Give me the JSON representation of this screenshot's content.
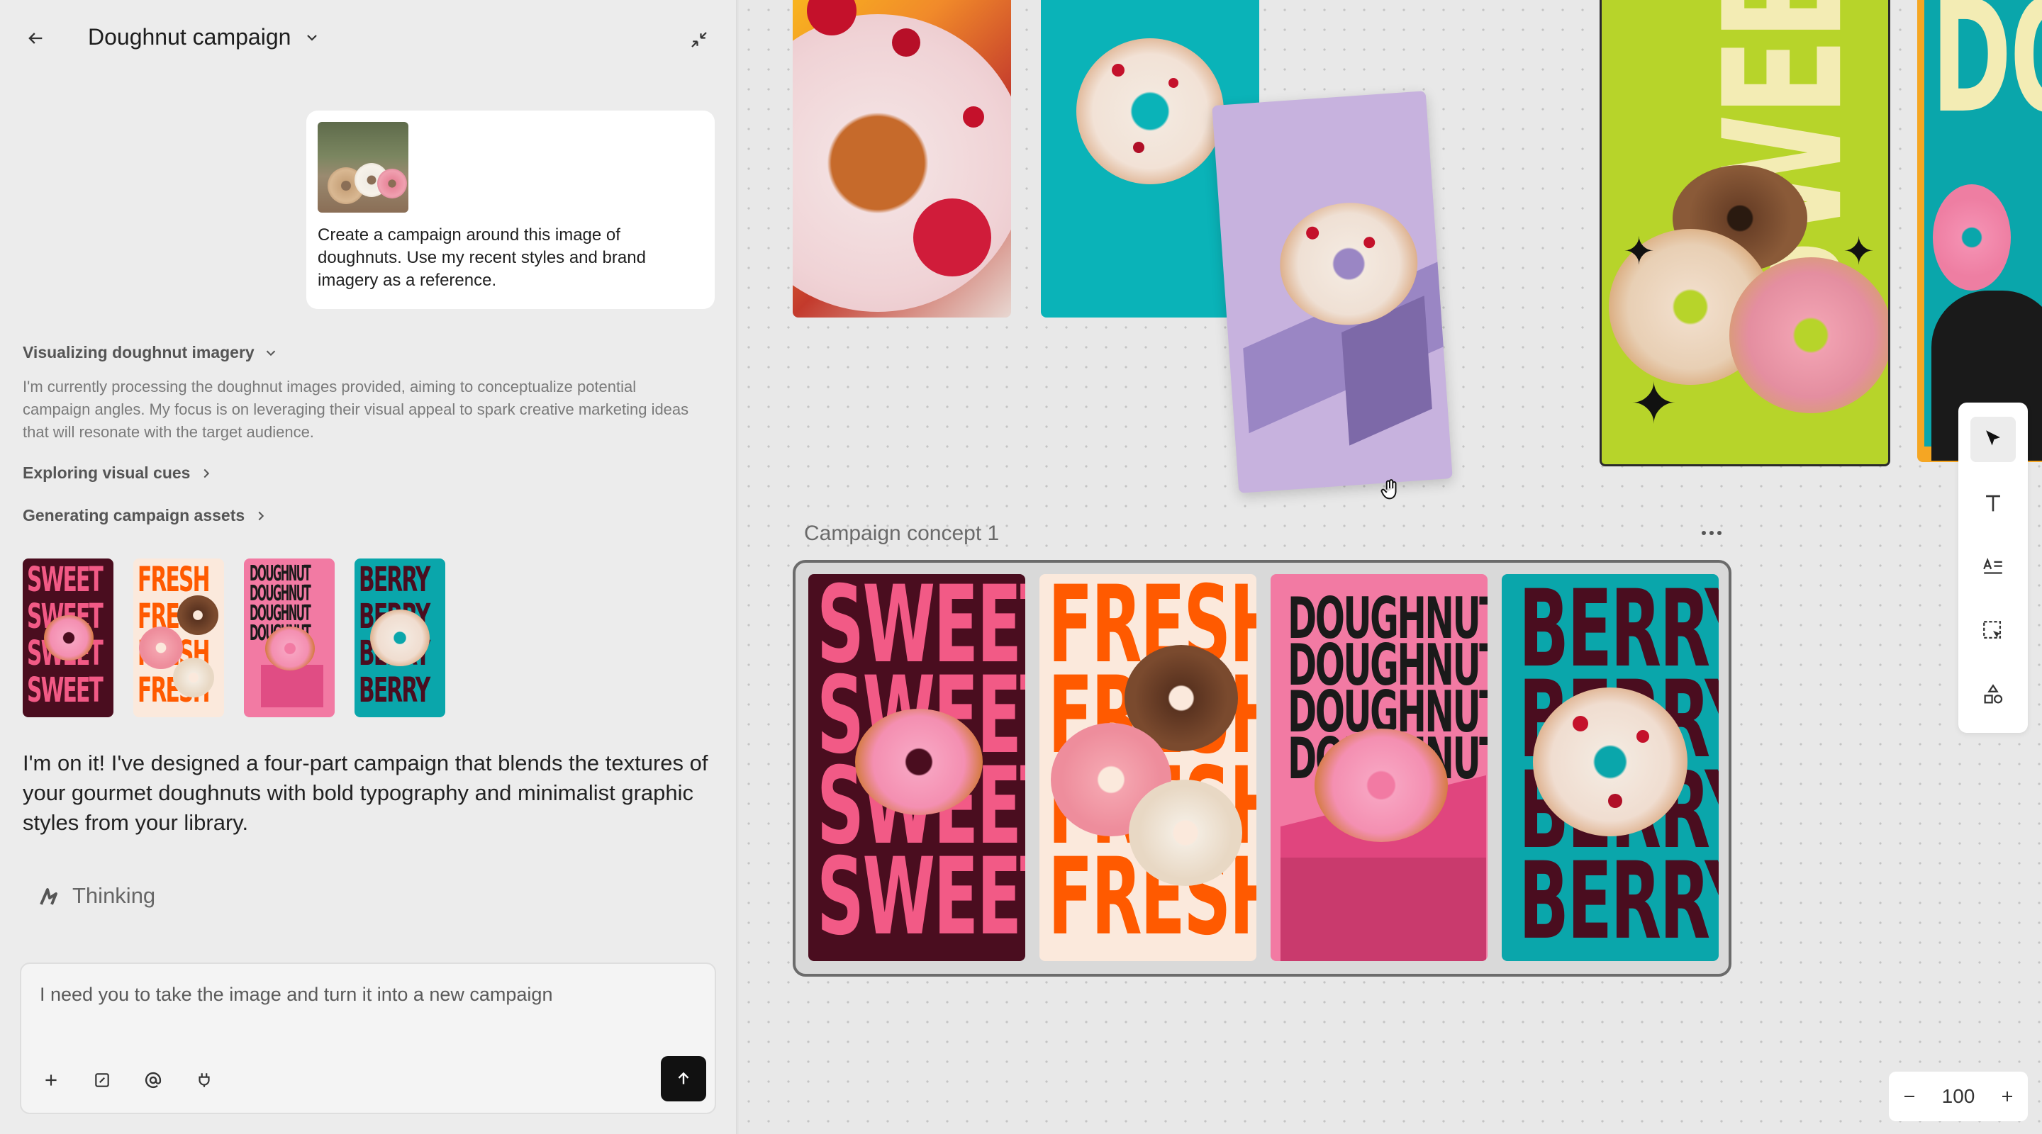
{
  "header": {
    "title": "Doughnut campaign"
  },
  "message": {
    "text": "Create a campaign around this image of doughnuts. Use my recent styles and brand imagery as a reference."
  },
  "steps": [
    {
      "label": "Visualizing doughnut imagery"
    },
    {
      "label": "Exploring visual cues"
    },
    {
      "label": "Generating campaign assets"
    }
  ],
  "step_description": "I'm currently processing the doughnut images provided, aiming to conceptualize potential campaign angles. My focus is on leveraging their visual appeal to spark creative marketing ideas that will resonate with the target audience.",
  "thumbnails": [
    {
      "word": "SWEET"
    },
    {
      "word": "FRESH"
    },
    {
      "word": "DOUGHNUT"
    },
    {
      "word": "BERRY"
    }
  ],
  "reply": "I'm on it! I've designed a four-part campaign that blends the textures of your gourmet doughnuts with bold typography and minimalist graphic styles from your library.",
  "status": {
    "label": "Thinking"
  },
  "composer": {
    "text": "I need you to take the image and turn it into a new campaign"
  },
  "canvas": {
    "frame_title": "Campaign concept 1",
    "poster_words": [
      "SWEET",
      "FRESH",
      "DOUGHNUT",
      "BERRY"
    ],
    "top_poster_word": "SWEET",
    "zoom": "100"
  },
  "colors": {
    "sweet_bg": "#4a0d1f",
    "sweet_text": "#f25a86",
    "fresh_bg": "#fbe9dc",
    "fresh_text": "#ff5a00",
    "doughnut_bg": "#f27aa3",
    "doughnut_text": "#1a1a1a",
    "berry_bg": "#0aa6ab",
    "berry_text": "#4a0d1f"
  }
}
